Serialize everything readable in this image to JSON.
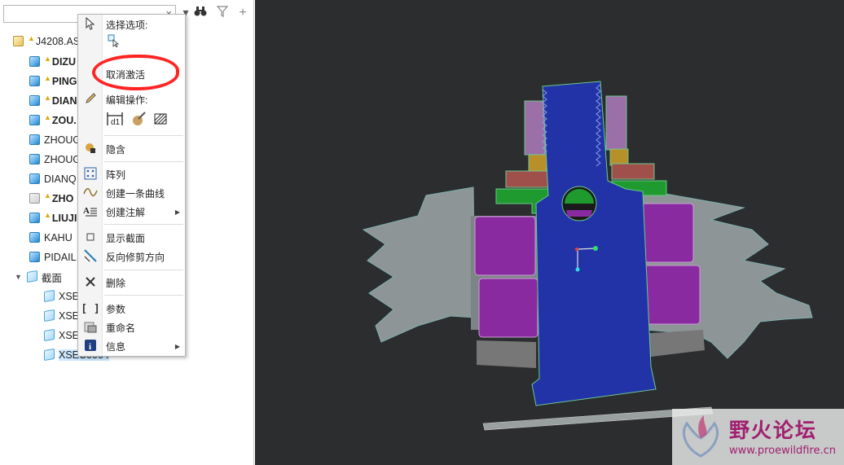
{
  "tree": {
    "search_value": "",
    "search_clear": "×",
    "toolbar_icons": [
      "binoculars-icon",
      "filter-icon",
      "add-icon"
    ],
    "root": "J4208.AS",
    "items": [
      {
        "label": "DIZU",
        "bold": true,
        "warning": true
      },
      {
        "label": "PING",
        "bold": true,
        "warning": true
      },
      {
        "label": "DIAN",
        "bold": true,
        "warning": true
      },
      {
        "label": "ZOU.",
        "bold": true,
        "warning": true
      },
      {
        "label": "ZHOUG",
        "bold": false,
        "warning": false
      },
      {
        "label": "ZHOUG",
        "bold": false,
        "warning": false
      },
      {
        "label": "DIANQ",
        "bold": false,
        "warning": false
      },
      {
        "label": "ZHO",
        "bold": true,
        "warning": true
      },
      {
        "label": "LIUJI",
        "bold": true,
        "warning": true
      },
      {
        "label": "KAHU",
        "bold": false,
        "warning": false
      },
      {
        "label": "PIDAIL",
        "bold": false,
        "warning": false
      }
    ],
    "sections_label": "截面",
    "sections": [
      "XSE",
      "XSE",
      "XSE",
      "XSEC0004"
    ]
  },
  "context_menu": {
    "select_options_header": "选择选项:",
    "deactivate": "取消激活",
    "edit_operations_header": "编辑操作:",
    "hide": "隐含",
    "pattern": "阵列",
    "create_curve": "创建一条曲线",
    "create_annotation": "创建注解",
    "show_section": "显示截面",
    "reverse_clip": "反向修剪方向",
    "delete": "删除",
    "parameters": "参数",
    "rename": "重命名",
    "info": "信息"
  },
  "watermark": {
    "title": "野火论坛",
    "url": "www.proewildfire.cn"
  },
  "colors": {
    "viewport_bg": "#2b2d2e",
    "shaft_blue": "#2233a8",
    "bearing_purple": "#8a2aa0",
    "housing_grey": "#8e9596",
    "highlight_red": "#ff2424",
    "watermark_text": "#a01f6e"
  }
}
